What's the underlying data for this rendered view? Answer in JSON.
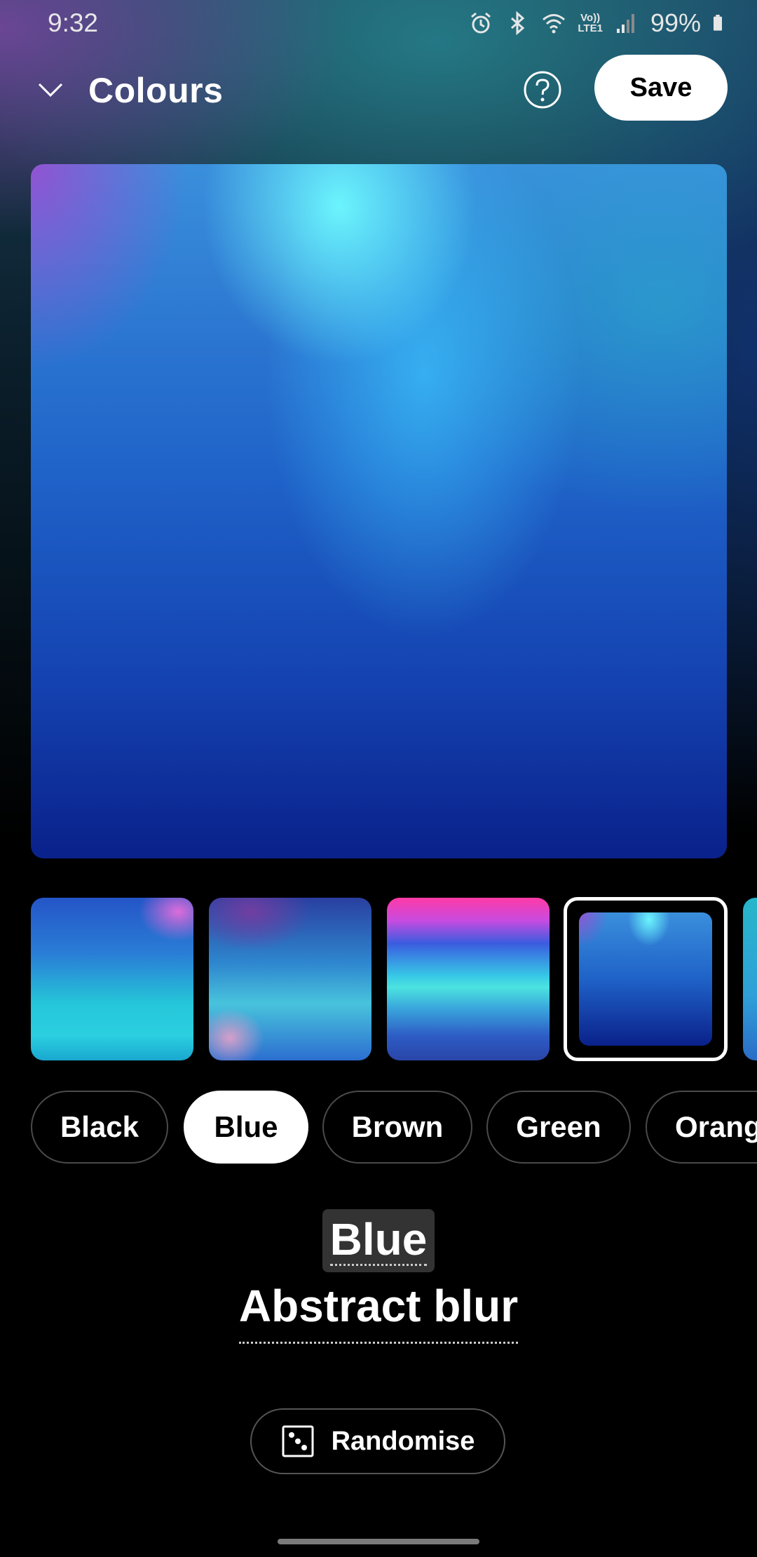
{
  "status_bar": {
    "time": "9:32",
    "lte_line1": "Vo))",
    "lte_line2": "LTE1",
    "battery": "99%"
  },
  "header": {
    "title": "Colours",
    "save_label": "Save",
    "help_icon": "help-circle-icon",
    "collapse_icon": "chevron-down-icon"
  },
  "thumbnails": {
    "selected_index": 3
  },
  "color_chips": [
    {
      "label": "Black",
      "selected": false
    },
    {
      "label": "Blue",
      "selected": true
    },
    {
      "label": "Brown",
      "selected": false
    },
    {
      "label": "Green",
      "selected": false
    },
    {
      "label": "Orang",
      "selected": false
    }
  ],
  "selection": {
    "colour_name": "Blue",
    "style_name": "Abstract blur"
  },
  "randomise": {
    "label": "Randomise",
    "icon": "dice-icon"
  },
  "colors": {
    "save_bg": "#ffffff",
    "chip_selected_bg": "#ffffff",
    "chip_border": "#4a4a4a"
  }
}
